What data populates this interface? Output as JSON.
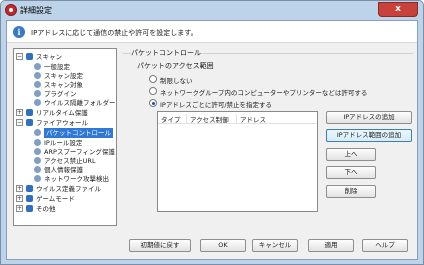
{
  "window": {
    "title": "詳細設定",
    "close_label": "x"
  },
  "banner": {
    "text": "IPアドレスに応じて通信の禁止や許可を設定します。"
  },
  "tree": {
    "items": [
      {
        "label": "スキャン",
        "level": 0,
        "expander": "−"
      },
      {
        "label": "一般設定",
        "level": 1
      },
      {
        "label": "スキャン設定",
        "level": 1
      },
      {
        "label": "スキャン対象",
        "level": 1
      },
      {
        "label": "プラグイン",
        "level": 1
      },
      {
        "label": "ウイルス隔離フォルダー",
        "level": 1
      },
      {
        "label": "リアルタイム保護",
        "level": 0,
        "expander": "+"
      },
      {
        "label": "ファイアウォール",
        "level": 0,
        "expander": "−"
      },
      {
        "label": "パケットコントロール",
        "level": 1,
        "selected": true
      },
      {
        "label": "IPルール設定",
        "level": 1
      },
      {
        "label": "ARPスプーフィング保護",
        "level": 1
      },
      {
        "label": "アクセス禁止URL",
        "level": 1
      },
      {
        "label": "個人情報保護",
        "level": 1
      },
      {
        "label": "ネットワーク攻撃検出",
        "level": 1
      },
      {
        "label": "ウイルス定義ファイル",
        "level": 0,
        "expander": "+"
      },
      {
        "label": "ゲームモード",
        "level": 0,
        "expander": "+"
      },
      {
        "label": "その他",
        "level": 0,
        "expander": "+"
      }
    ]
  },
  "panel": {
    "group_title": "パケットコントロール",
    "subheading": "パケットのアクセス範囲",
    "radios": [
      {
        "label": "制限しない",
        "checked": false
      },
      {
        "label": "ネットワークグループ内のコンピューターやプリンターなどは許可する",
        "checked": false
      },
      {
        "label": "IPアドレスごとに許可/禁止を指定する",
        "checked": true
      }
    ],
    "list_columns": [
      "タイプ",
      "アクセス制御",
      "アドレス"
    ],
    "side_buttons": {
      "add_address": "IPアドレスの追加",
      "add_range": "IPアドレス範囲の追加",
      "up": "上へ",
      "down": "下へ",
      "delete": "削除"
    }
  },
  "footer": {
    "reset": "初期値に戻す",
    "ok": "OK",
    "cancel": "キャンセル",
    "apply": "適用",
    "help": "ヘルプ"
  },
  "colors": {
    "selection": "#3078d8",
    "close_button": "#c8413a",
    "frame": "#bcd3ea"
  }
}
